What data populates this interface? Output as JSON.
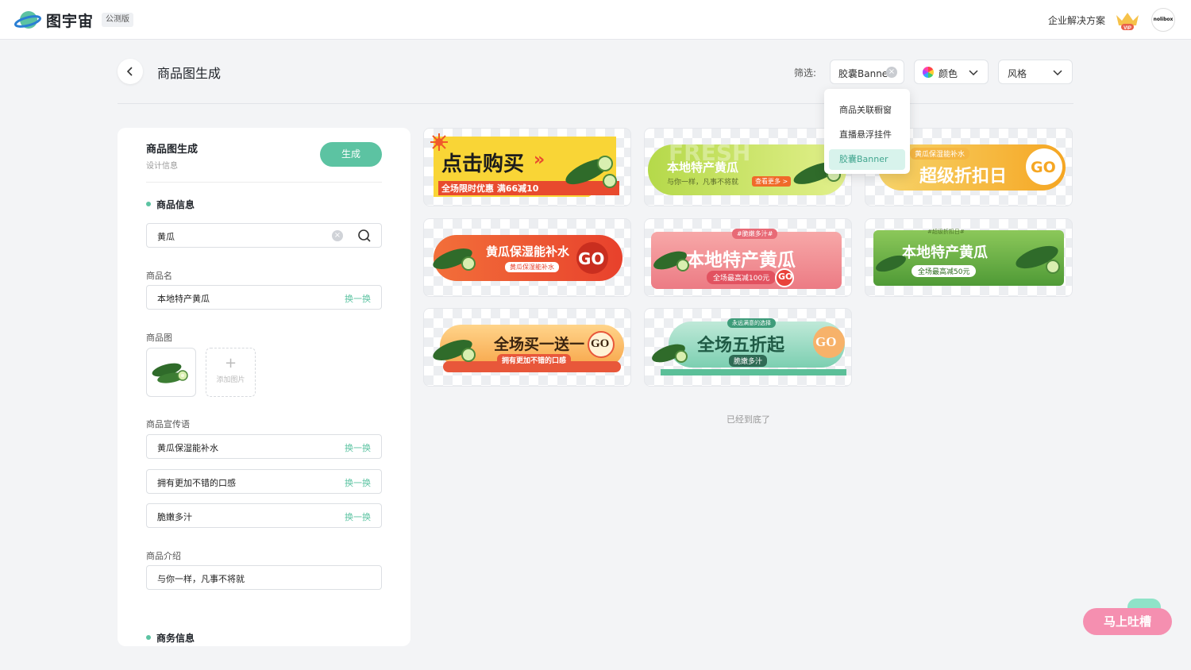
{
  "header": {
    "logo_text": "图宇宙",
    "beta_badge": "公测版",
    "enterprise_link": "企业解决方案",
    "vip_label": "VIP",
    "avatar_text": "nolibox"
  },
  "page": {
    "title": "商品图生成"
  },
  "filters": {
    "label": "筛选:",
    "type_value": "胶囊Banner",
    "color_label": "颜色",
    "style_label": "风格"
  },
  "dropdown": {
    "items": [
      "商品关联橱窗",
      "直播悬浮挂件",
      "胶囊Banner"
    ],
    "selected": "胶囊Banner"
  },
  "panel": {
    "title": "商品图生成",
    "subtitle": "设计信息",
    "generate_button": "生成",
    "section_product": "商品信息",
    "search_value": "黄瓜",
    "name_label": "商品名",
    "name_value": "本地特产黄瓜",
    "swap_label": "换一换",
    "image_label": "商品图",
    "add_image_label": "添加图片",
    "slogan_label": "商品宣传语",
    "slogans": [
      "黄瓜保湿能补水",
      "拥有更加不错的口感",
      "脆嫩多汁"
    ],
    "intro_label": "商品介绍",
    "intro_value": "与你一样，凡事不将就",
    "section_business": "商务信息"
  },
  "banners": [
    {
      "title": "点击购买",
      "arrows": "»",
      "sub": "全场限时优惠 满66减10"
    },
    {
      "ghost": "FRESH",
      "title": "本地特产黄瓜",
      "sub": "与你一样，凡事不将就",
      "btn": "查看更多 >"
    },
    {
      "tag": "黄瓜保湿能补水",
      "title": "超级折扣日",
      "go": "GO"
    },
    {
      "title": "黄瓜保湿能补水",
      "sub": "黄瓜保湿能补水",
      "go": "GO"
    },
    {
      "tag": "#脆嫩多汁#",
      "title": "本地特产黄瓜",
      "sub": "全场最高减100元",
      "go": "GO"
    },
    {
      "tag": "#超级折扣日#",
      "title": "本地特产黄瓜",
      "sub": "全场最高减50元"
    },
    {
      "title": "全场买一送一",
      "sub": "拥有更加不错的口感",
      "go": "GO"
    },
    {
      "tag": "永远满意的选择",
      "title": "全场五折起",
      "sub": "脆嫩多汁",
      "go": "GO"
    }
  ],
  "list_end": "已经到底了",
  "feedback_button": "马上吐槽",
  "colors": {
    "accent": "#5cc3a2",
    "feedback": "#f58fb0"
  }
}
